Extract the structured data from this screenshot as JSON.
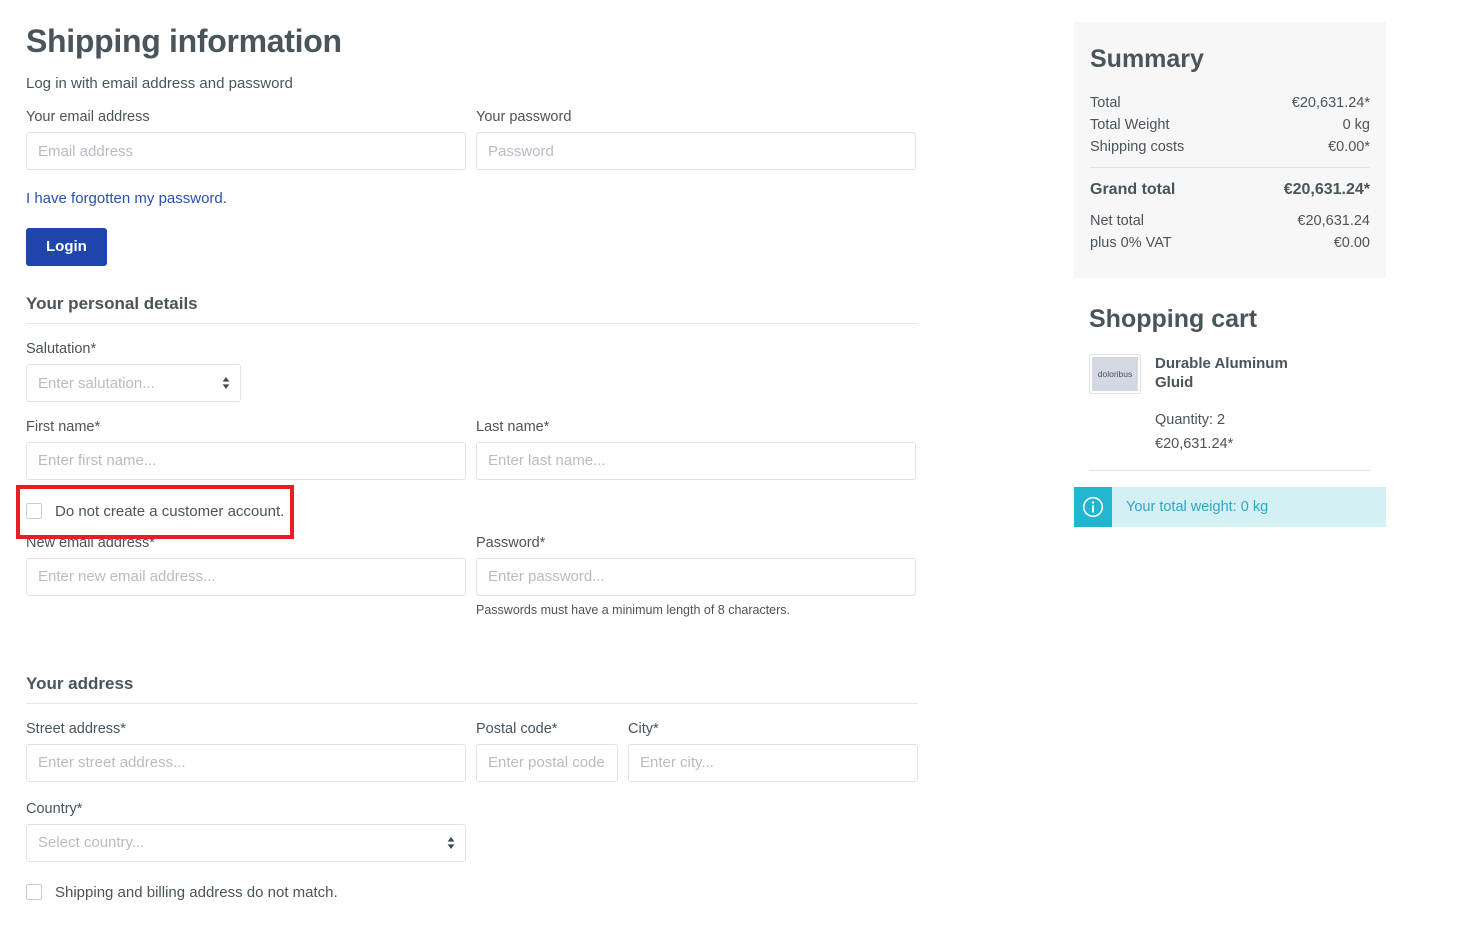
{
  "header": {
    "title": "Shipping information",
    "login_subtitle": "Log in with email address and password"
  },
  "login": {
    "email_label": "Your email address",
    "email_placeholder": "Email address",
    "email_value": "",
    "password_label": "Your password",
    "password_placeholder": "Password",
    "password_value": "",
    "forgot_link": "I have forgotten my password.",
    "login_button": "Login"
  },
  "personal": {
    "section_title": "Your personal details",
    "salutation_label": "Salutation*",
    "salutation_placeholder": "Enter salutation...",
    "salutation_value": "",
    "first_name_label": "First name*",
    "first_name_placeholder": "Enter first name...",
    "first_name_value": "",
    "last_name_label": "Last name*",
    "last_name_placeholder": "Enter last name...",
    "last_name_value": "",
    "no_account_checkbox_label": "Do not create a customer account.",
    "no_account_checked": false,
    "new_email_label": "New email address*",
    "new_email_placeholder": "Enter new email address...",
    "new_email_value": "",
    "password_label": "Password*",
    "password_placeholder": "Enter password...",
    "password_value": "",
    "password_help": "Passwords must have a minimum length of 8 characters."
  },
  "address": {
    "section_title": "Your address",
    "street_label": "Street address*",
    "street_placeholder": "Enter street address...",
    "street_value": "",
    "postal_label": "Postal code*",
    "postal_placeholder": "Enter postal code.",
    "postal_value": "",
    "city_label": "City*",
    "city_placeholder": "Enter city...",
    "city_value": "",
    "country_label": "Country*",
    "country_placeholder": "Select country...",
    "country_value": "",
    "billing_mismatch_label": "Shipping and billing address do not match.",
    "billing_mismatch_checked": false
  },
  "summary": {
    "title": "Summary",
    "rows": [
      {
        "label": "Total",
        "value": "€20,631.24*"
      },
      {
        "label": "Total Weight",
        "value": "0 kg"
      },
      {
        "label": "Shipping costs",
        "value": "€0.00*"
      }
    ],
    "grand_total_label": "Grand total",
    "grand_total_value": "€20,631.24*",
    "net_rows": [
      {
        "label": "Net total",
        "value": "€20,631.24"
      },
      {
        "label": "plus 0% VAT",
        "value": "€0.00"
      }
    ]
  },
  "cart": {
    "title": "Shopping cart",
    "item": {
      "thumb_text": "doloribus",
      "name": "Durable Aluminum Gluid",
      "quantity": "Quantity: 2",
      "price": "€20,631.24*"
    },
    "alert_text": "Your total weight: 0 kg"
  },
  "colors": {
    "accent_blue": "#1e45ac",
    "link_blue": "#2b50b4",
    "text": "#4a545b",
    "panel_bg": "#f7f7f8",
    "alert_bg": "#d5f0f5",
    "alert_icon_bg": "#21b6d0",
    "alert_text": "#2aa8c4",
    "annotation_red": "#ec1c24",
    "border": "#dfe3e8"
  },
  "icons": {
    "select_arrow": "select-arrow-icon",
    "info": "info-icon"
  }
}
